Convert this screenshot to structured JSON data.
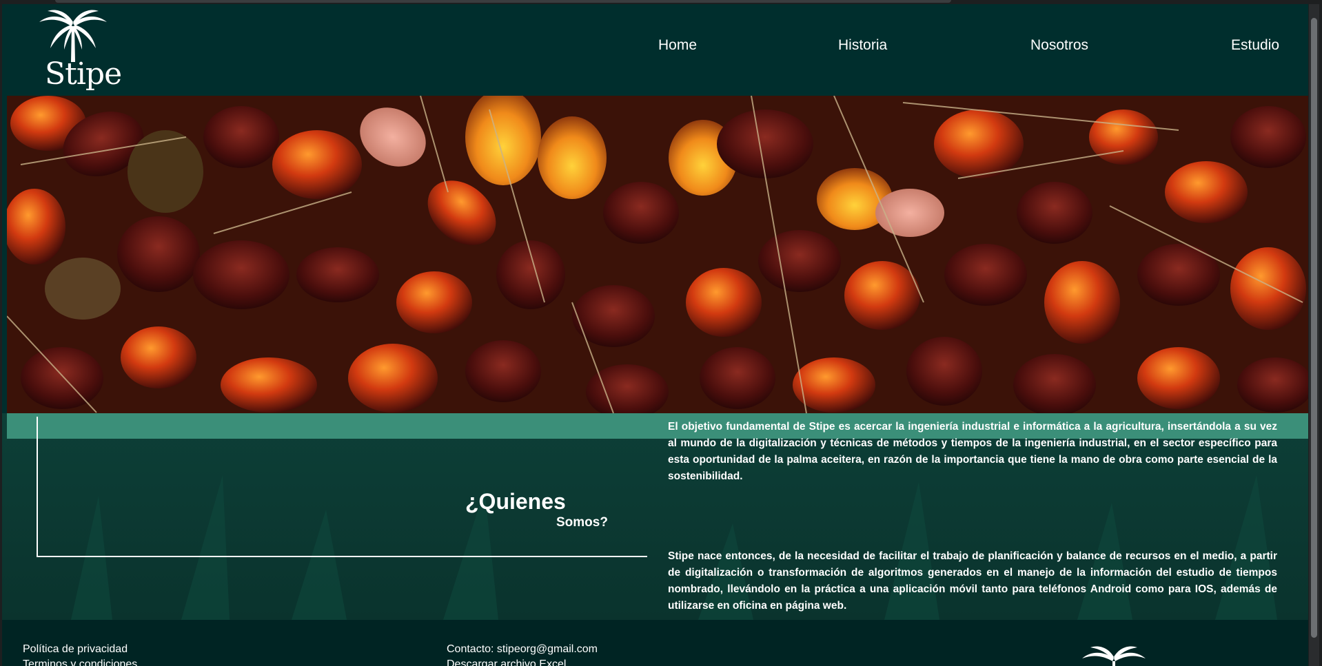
{
  "header": {
    "logo_text": "Stipe",
    "nav": [
      "Home",
      "Historia",
      "Nosotros",
      "Estudio"
    ]
  },
  "about": {
    "heading_line1": "¿Quienes",
    "heading_line2": "Somos?",
    "paragraph1": "El objetivo fundamental de Stipe es acercar la ingeniería industrial e informática a la agricultura, insertándola a su vez al mundo de la digitalización y técnicas de métodos y tiempos de la ingeniería industrial, en el sector específico para esta oportunidad de la palma aceitera, en razón de la importancia que tiene la mano de obra como parte esencial de la sostenibilidad.",
    "paragraph2": "Stipe nace entonces, de la necesidad de facilitar el trabajo de planificación y balance de recursos en el medio, a partir de digitalización o transformación de algoritmos generados en el manejo de la información del estudio de tiempos nombrado, llevándolo en la práctica a una aplicación móvil tanto para teléfonos Android como para IOS, además de utilizarse en oficina en página web."
  },
  "footer": {
    "privacy": "Política de privacidad",
    "terms": "Terminos y condiciones",
    "contact": "Contacto: stipeorg@gmail.com",
    "download": "Descargar archivo Excel"
  },
  "colors": {
    "header_bg": "#002e2d",
    "band": "#3b8f79",
    "footer_bg": "#002423"
  }
}
